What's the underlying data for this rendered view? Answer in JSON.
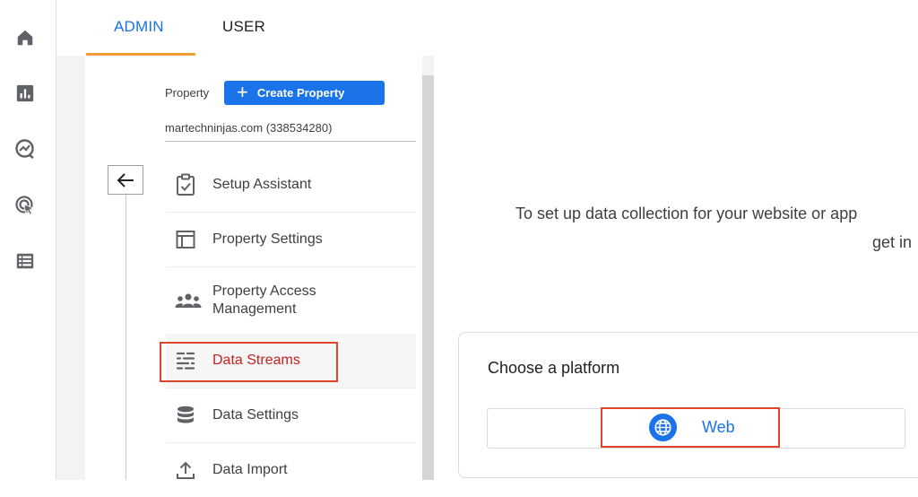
{
  "tabs": [
    {
      "label": "ADMIN",
      "active": true
    },
    {
      "label": "USER",
      "active": false
    }
  ],
  "rail": [
    {
      "icon": "home-icon"
    },
    {
      "icon": "reports-icon"
    },
    {
      "icon": "explore-icon"
    },
    {
      "icon": "advertising-icon"
    },
    {
      "icon": "configure-icon"
    }
  ],
  "property": {
    "label": "Property",
    "create_label": "Create Property",
    "name": "martechninjas.com (338534280)"
  },
  "nav": {
    "items": [
      {
        "label": "Setup Assistant",
        "icon": "checklist-icon"
      },
      {
        "label": "Property Settings",
        "icon": "settings-panel-icon"
      },
      {
        "label": "Property Access Management",
        "icon": "people-icon"
      },
      {
        "label": "Data Streams",
        "icon": "data-streams-icon",
        "selected": true
      },
      {
        "label": "Data Settings",
        "icon": "database-icon"
      },
      {
        "label": "Data Import",
        "icon": "upload-icon"
      }
    ]
  },
  "main": {
    "info_line1": "To set up data collection for your website or app",
    "info_line2": "get in",
    "platform_title": "Choose a platform",
    "web_label": "Web"
  },
  "colors": {
    "accent": "#1a73e8",
    "tab_underline": "#f29d38",
    "highlight": "#e0452b",
    "selected_text": "#c5221f"
  }
}
